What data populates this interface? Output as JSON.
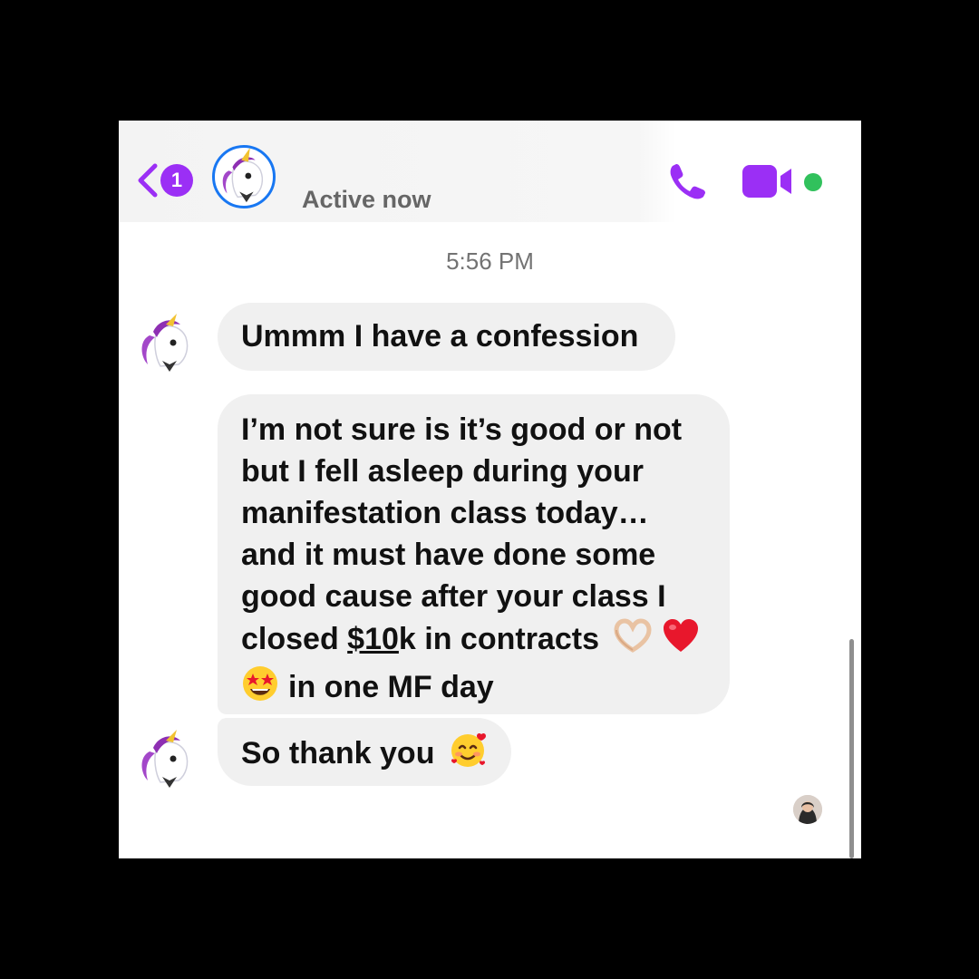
{
  "header": {
    "unread_count": "1",
    "status": "Active now",
    "icons": [
      "chevron-left-icon",
      "phone-icon",
      "video-camera-icon"
    ],
    "accent_color": "#9b2ff5",
    "online_color": "#31c15c"
  },
  "conversation": {
    "timestamp": "5:56 PM",
    "messages": [
      {
        "text": "Ummm  I have a confession"
      },
      {
        "lines": [
          "I’m not sure is it’s good or not",
          "but I fell asleep during your",
          "manifestation class today…",
          "and it must have done some",
          "good cause after your class I"
        ],
        "line6_prefix": "closed ",
        "line6_underlined": "$10",
        "line6_suffix": "k in contracts",
        "line7": "in one MF day",
        "emojis": [
          "heart-hands-emoji",
          "red-heart-emoji",
          "star-struck-emoji"
        ]
      },
      {
        "text": "So thank you",
        "emojis": [
          "smiling-face-with-hearts-emoji"
        ]
      }
    ]
  }
}
